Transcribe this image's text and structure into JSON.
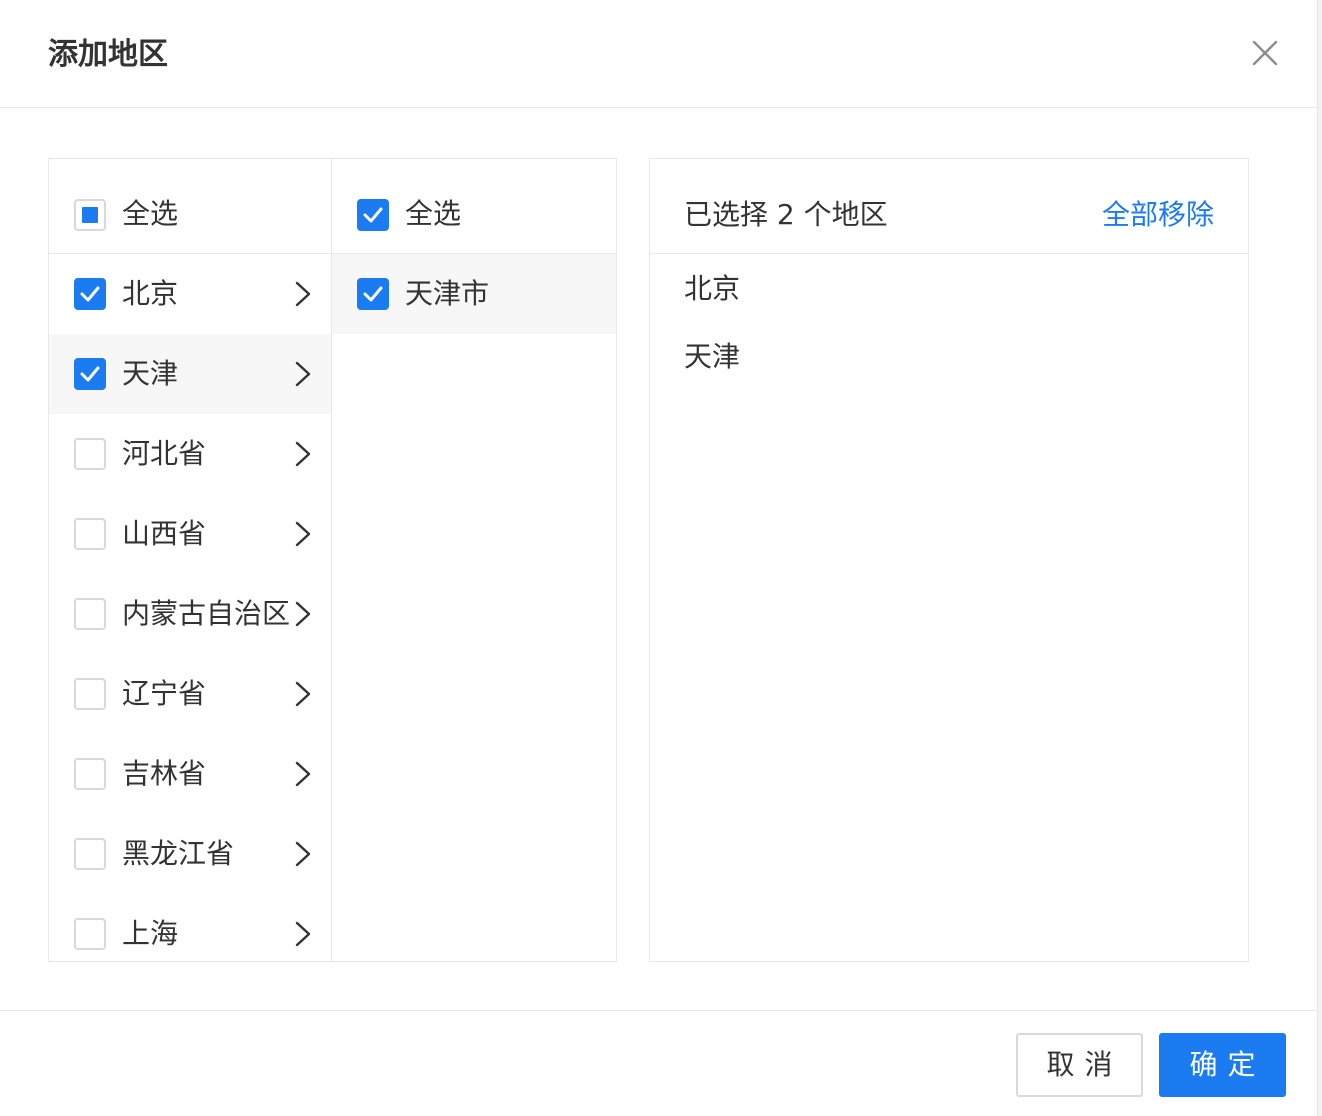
{
  "dialog": {
    "title": "添加地区",
    "close_icon": "close-icon"
  },
  "provinces": {
    "select_all_label": "全选",
    "select_all_state": "indeterminate",
    "items": [
      {
        "label": "北京",
        "checked": true,
        "active": false
      },
      {
        "label": "天津",
        "checked": true,
        "active": true
      },
      {
        "label": "河北省",
        "checked": false,
        "active": false
      },
      {
        "label": "山西省",
        "checked": false,
        "active": false
      },
      {
        "label": "内蒙古自治区",
        "checked": false,
        "active": false
      },
      {
        "label": "辽宁省",
        "checked": false,
        "active": false
      },
      {
        "label": "吉林省",
        "checked": false,
        "active": false
      },
      {
        "label": "黑龙江省",
        "checked": false,
        "active": false
      },
      {
        "label": "上海",
        "checked": false,
        "active": false
      }
    ]
  },
  "cities": {
    "select_all_label": "全选",
    "select_all_state": "checked",
    "items": [
      {
        "label": "天津市",
        "checked": true,
        "active": true
      }
    ]
  },
  "selected": {
    "summary": "已选择 2 个地区",
    "remove_all_label": "全部移除",
    "items": [
      "北京",
      "天津"
    ]
  },
  "footer": {
    "cancel_label": "取消",
    "ok_label": "确定"
  },
  "colors": {
    "primary": "#1a7cf0",
    "border": "#e8e8e8",
    "active_row": "#f7f7f7"
  }
}
